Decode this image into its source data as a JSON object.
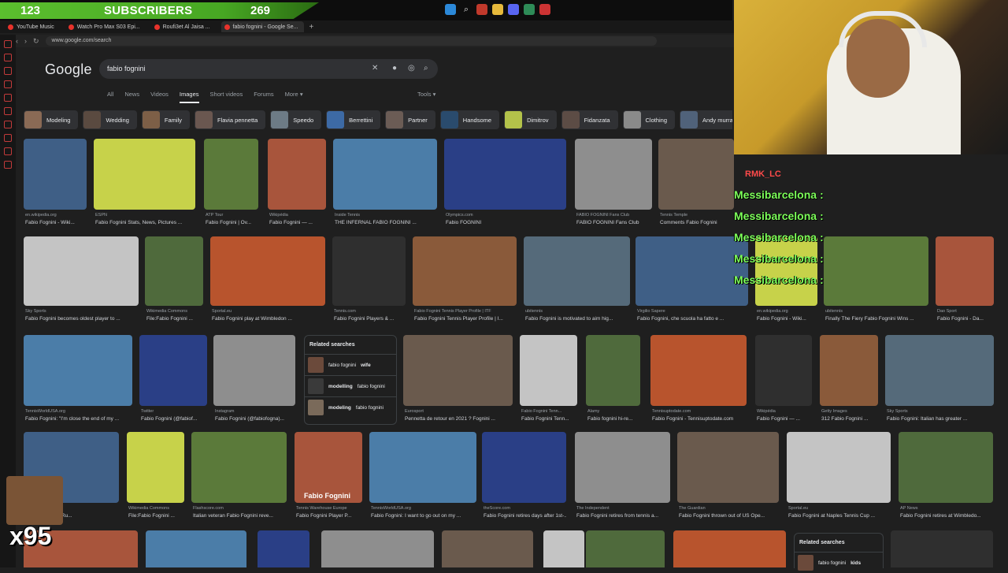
{
  "overlay": {
    "sub_count": "123",
    "sub_label": "SUBSCRIBERS",
    "sub_goal": "269",
    "chat_user": "RMK_LC",
    "chat_lines": [
      "Messibarcelona :",
      "Messibarcelona :",
      "Messibarcelona :",
      "Messibarcelona :",
      "Messibarcelona :"
    ],
    "multiplier": "x95"
  },
  "browser": {
    "tabs": [
      "YouTube Music",
      "Watch Pro Max S03 Epi...",
      "Roufi3et Al Jaisa ...",
      "fabio fognini - Google Se..."
    ],
    "url": "www.google.com/search"
  },
  "google": {
    "logo": "Google",
    "query": "fabio fognini",
    "tabs": [
      "All",
      "News",
      "Videos",
      "Images",
      "Short videos",
      "Forums",
      "More"
    ],
    "tools": "Tools",
    "chips": [
      "Modeling",
      "Wedding",
      "Family",
      "Flavia pennetta",
      "Speedo",
      "Berrettini",
      "Partner",
      "Handsome",
      "Dimitrov",
      "Fidanzata",
      "Clothing",
      "Andy murray"
    ]
  },
  "results": [
    {
      "src": "en.wikipedia.org",
      "cap": "Fabio Fognini - Wiki..."
    },
    {
      "src": "ESPN",
      "cap": "Fabio Fognini Stats, News, Pictures ..."
    },
    {
      "src": "ATP Tour",
      "cap": "Fabio Fognini | Ov..."
    },
    {
      "src": "Wikipédia",
      "cap": "Fabio Fognini — ..."
    },
    {
      "src": "Inside Tennis",
      "cap": "THE INFERNAL FABIO FOGNINI ..."
    },
    {
      "src": "Olympics.com",
      "cap": "Fabio FOGNINI"
    },
    {
      "src": "FABIO FOGNINI Fans Club",
      "cap": "FABIO FOGNINI Fans Club"
    },
    {
      "src": "Tennis Temple",
      "cap": "Comments Fabio Fognini"
    },
    {
      "src": "Sky Sports",
      "cap": "Fabio Fognini becomes oldest player to ..."
    },
    {
      "src": "Wikimedia Commons",
      "cap": "File:Fabio Fognini ..."
    },
    {
      "src": "Sportal.eu",
      "cap": "Fabio Fognini play at Wimbledon ..."
    },
    {
      "src": "Tennis.com",
      "cap": "Fabio Fognini Players & ..."
    },
    {
      "src": "Fabio Fognini Tennis Player Profile | ITF",
      "cap": "Fabio Fognini Tennis Player Profile | I..."
    },
    {
      "src": "ubitennis",
      "cap": "Fabio Fognini is motivated to aim hig..."
    },
    {
      "src": "Virgilio Sapere",
      "cap": "Fabio Fognini, che scuola ha fatto e ..."
    },
    {
      "src": "en.wikipedia.org",
      "cap": "Fabio Fognini - Wiki..."
    },
    {
      "src": "ubitennis",
      "cap": "Finally The Fiery Fabio Fognini Wins ..."
    },
    {
      "src": "Dao Sport",
      "cap": "Fabio Fognini - Da..."
    },
    {
      "src": "TennisWorldUSA.org",
      "cap": "Fabio Fognini: \"I'm close the end of my ..."
    },
    {
      "src": "Twitter",
      "cap": "Fabio Fognini (@fabiof..."
    },
    {
      "src": "Instagram",
      "cap": "Fabio Fognini (@fabiofogna)..."
    },
    {
      "src": "Eurosport",
      "cap": "Pennetta de retour en 2021 ? Fognini ..."
    },
    {
      "src": "Fabio Fognini Tenn...",
      "cap": "Fabio Fognini Tenn..."
    },
    {
      "src": "Alamy",
      "cap": "Fabio fognini hi-re..."
    },
    {
      "src": "Tennisuptodate.com",
      "cap": "Fabio Fognini - Tennisuptodate.com"
    },
    {
      "src": "Wikipédia",
      "cap": "Fabio Fognini — ..."
    },
    {
      "src": "Getty Images",
      "cap": "312 Fabio Fognini ..."
    },
    {
      "src": "Sky Sports",
      "cap": "Fabio Fognini: Italian has greater ..."
    },
    {
      "src": "",
      "cap": "defeats Casper Ru..."
    },
    {
      "src": "Wikimedia Commons",
      "cap": "File:Fabio Fognini ..."
    },
    {
      "src": "Flashscore.com",
      "cap": "Italian veteran Fabio Fognini reve..."
    },
    {
      "src": "Tennis Warehouse Europe",
      "cap": "Fabio Fognini Player P..."
    },
    {
      "src": "TennisWorldUSA.org",
      "cap": "Fabio Fognini: I want to go out on my ..."
    },
    {
      "src": "theScore.com",
      "cap": "Fabio Fognini retires days after 1st-..."
    },
    {
      "src": "The Independent",
      "cap": "Fabio Fognini retires from tennis a..."
    },
    {
      "src": "The Guardian",
      "cap": "Fabio Fognini thrown out of US Ope..."
    },
    {
      "src": "Sportal.eu",
      "cap": "Fabio Fognini at Naples Tennis Cup ..."
    },
    {
      "src": "AP News",
      "cap": "Fabio Fognini retires at Wimbledo..."
    }
  ],
  "related1": {
    "header": "Related searches",
    "items": [
      {
        "a": "fabio fognini ",
        "b": "wife"
      },
      {
        "a": "",
        "b": "modelling",
        "c": " fabio fognini"
      },
      {
        "a": "",
        "b": "modeling",
        "c": " fabio fognini"
      }
    ]
  },
  "related2": {
    "header": "Related searches",
    "item_a": "fabio fognini ",
    "item_b": "kids"
  },
  "caption_overlay": "Fabio Fognini"
}
